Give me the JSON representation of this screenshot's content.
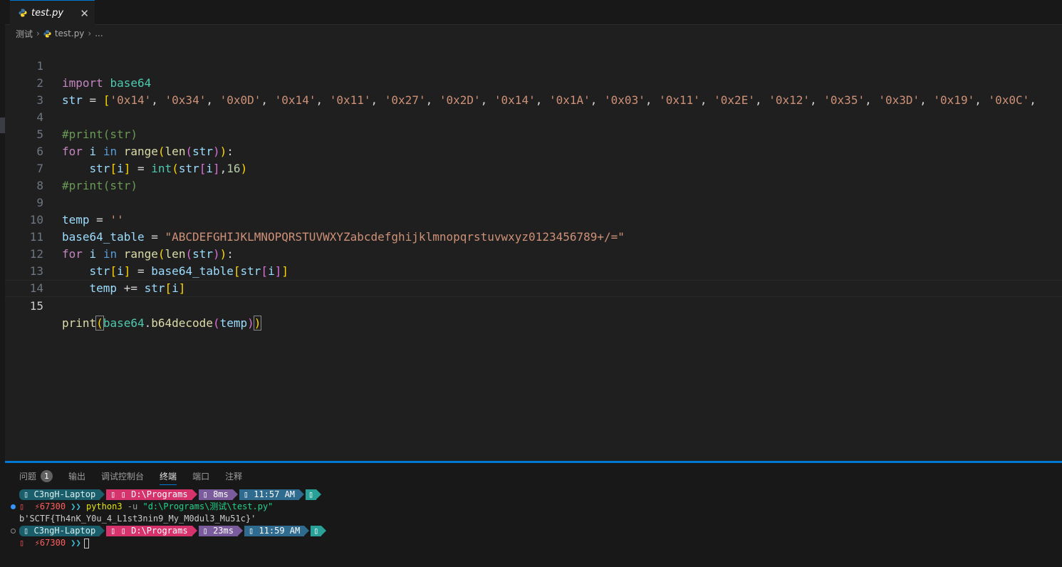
{
  "tab": {
    "label": "test.py",
    "close": "✕"
  },
  "breadcrumb": {
    "folder": "测试",
    "file": "test.py",
    "more": "..."
  },
  "editor": {
    "current_line": 15,
    "lines": [
      {
        "n": "1"
      },
      {
        "n": "2"
      },
      {
        "n": "3"
      },
      {
        "n": "4"
      },
      {
        "n": "5"
      },
      {
        "n": "6"
      },
      {
        "n": "7"
      },
      {
        "n": "8"
      },
      {
        "n": "9"
      },
      {
        "n": "10"
      },
      {
        "n": "11"
      },
      {
        "n": "12"
      },
      {
        "n": "13"
      },
      {
        "n": "14"
      },
      {
        "n": "15"
      }
    ],
    "tokens": {
      "import": "import",
      "base64": "base64",
      "str": "str",
      "eq": "=",
      "hex_values": [
        "'0x14'",
        "'0x34'",
        "'0x0D'",
        "'0x14'",
        "'0x11'",
        "'0x27'",
        "'0x2D'",
        "'0x14'",
        "'0x1A'",
        "'0x03'",
        "'0x11'",
        "'0x2E'",
        "'0x12'",
        "'0x35'",
        "'0x3D'",
        "'0x19'",
        "'0x0C'"
      ],
      "comment_print": "#print(str)",
      "for": "for",
      "i": "i",
      "in": "in",
      "range": "range",
      "len": "len",
      "int": "int",
      "sixteen": "16",
      "temp": "temp",
      "empty_str": "''",
      "base64_table": "base64_table",
      "table_value": "\"ABCDEFGHIJKLMNOPQRSTUVWXYZabcdefghijklmnopqrstuvwxyz0123456789+/=\"",
      "plus_eq": "+=",
      "print": "print",
      "b64decode": "b64decode"
    }
  },
  "panel": {
    "tabs": [
      {
        "label": "问题",
        "badge": "1"
      },
      {
        "label": "输出"
      },
      {
        "label": "调试控制台"
      },
      {
        "label": "终端",
        "active": true
      },
      {
        "label": "端口"
      },
      {
        "label": "注释"
      }
    ]
  },
  "terminal": {
    "prompt1": {
      "host": "C3ngH-Laptop",
      "path": "D:\\Programs",
      "duration": "8ms",
      "time": "11:57 AM"
    },
    "cmd_line": {
      "err": "67300",
      "chevrons": "❯❯",
      "cmd": "python3",
      "flag": "-u",
      "arg": "\"d:\\Programs\\测试\\test.py\""
    },
    "output": "b'SCTF{Th4nK_Y0u_4_L1st3nin9_My_M0dul3_Mu51c}'",
    "prompt2": {
      "host": "C3ngH-Laptop",
      "path": "D:\\Programs",
      "duration": "23ms",
      "time": "11:59 AM"
    },
    "last_line": {
      "err": "67300",
      "chevrons": "❯❯"
    },
    "glyph": "▯"
  },
  "colors": {
    "accent": "#0078d4",
    "editor_bg": "#1f1f1f",
    "panel_bg": "#181818"
  }
}
